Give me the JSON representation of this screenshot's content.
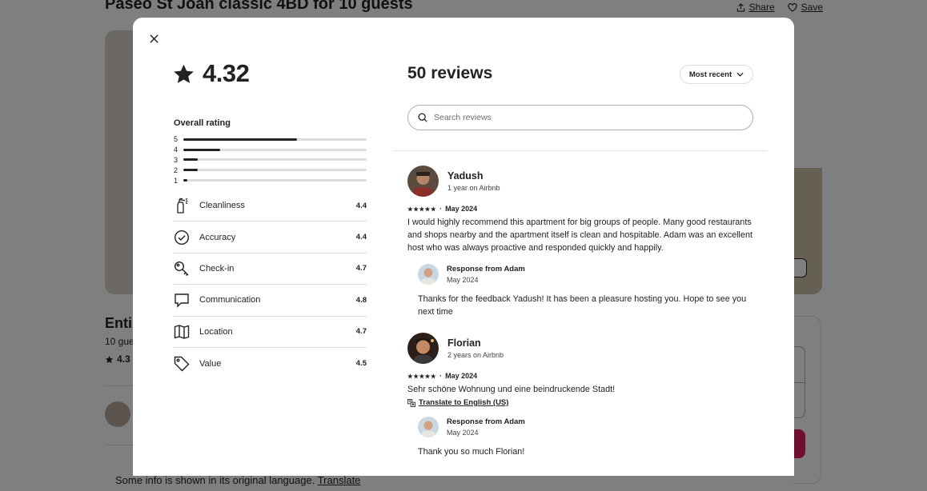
{
  "background": {
    "title": "Paseo St Joan classic 4BD for 10 guests",
    "share_label": "Share",
    "save_label": "Save",
    "entire_partial": "Entir",
    "guests_partial": "10 gue",
    "rating_partial": "4.3",
    "footer_text": "Some info is shown in its original language.",
    "footer_link": "Translate"
  },
  "modal": {
    "overall_rating": "4.32",
    "overall_label": "Overall rating",
    "distribution": [
      {
        "label": "5",
        "fraction": 0.62
      },
      {
        "label": "4",
        "fraction": 0.2
      },
      {
        "label": "3",
        "fraction": 0.08
      },
      {
        "label": "2",
        "fraction": 0.08
      },
      {
        "label": "1",
        "fraction": 0.02
      }
    ],
    "categories": [
      {
        "name": "Cleanliness",
        "score": "4.4",
        "icon": "spray-bottle-icon"
      },
      {
        "name": "Accuracy",
        "score": "4.4",
        "icon": "check-circle-icon"
      },
      {
        "name": "Check-in",
        "score": "4.7",
        "icon": "key-icon"
      },
      {
        "name": "Communication",
        "score": "4.8",
        "icon": "chat-bubble-icon"
      },
      {
        "name": "Location",
        "score": "4.7",
        "icon": "map-icon"
      },
      {
        "name": "Value",
        "score": "4.5",
        "icon": "tag-icon"
      }
    ],
    "reviews_title": "50 reviews",
    "sort_label": "Most recent",
    "search_placeholder": "Search reviews",
    "reviews": [
      {
        "name": "Yadush",
        "tenure": "1 year on Airbnb",
        "stars": "★★★★★",
        "date": "May 2024",
        "text": "I would highly recommend this apartment for big groups of people. Many good restaurants and shops nearby and the apartment itself is clean and hospitable. Adam was an excellent host who was always proactive and responded quickly and happily.",
        "response_from": "Response from Adam",
        "response_date": "May 2024",
        "response_text": "Thanks for the feedback Yadush! It has been a pleasure hosting you. Hope to see you next time"
      },
      {
        "name": "Florian",
        "tenure": "2 years on Airbnb",
        "stars": "★★★★★",
        "date": "May 2024",
        "text": "Sehr schöne Wohnung und eine beindruckende Stadt!",
        "translate_label": "Translate to English (US)",
        "response_from": "Response from Adam",
        "response_date": "May 2024",
        "response_text": "Thank you so much Florian!"
      }
    ]
  },
  "colors": {
    "accent": "#e01d5a",
    "text": "#222222",
    "border": "#dddddd"
  }
}
